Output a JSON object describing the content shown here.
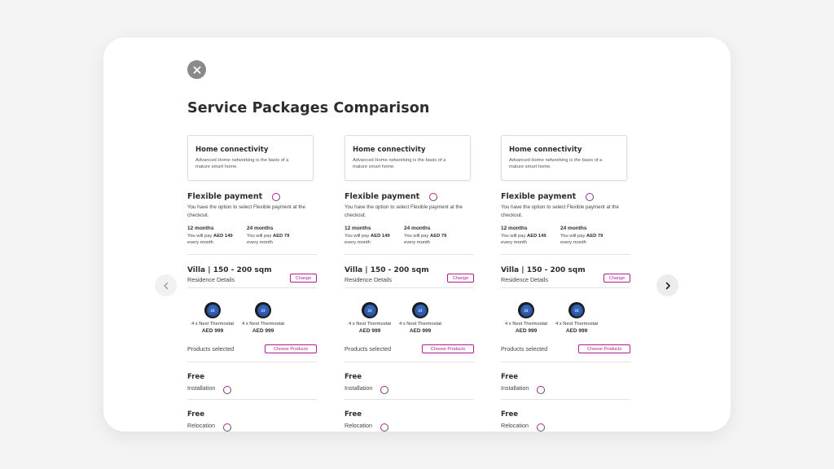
{
  "title": "Service Packages Comparison",
  "colors": {
    "accent": "#b21e8f",
    "close_bg": "#8a8a8a"
  },
  "icons": {
    "close": "close-icon",
    "prev": "chevron-left-icon",
    "next": "chevron-right-icon",
    "thermostat": "nest-thermostat-icon",
    "loading": "loading-ring-icon"
  },
  "columns": [
    {
      "card": {
        "title": "Home connectivity",
        "desc": "Advanced Home networking is the basis of a mature smart home."
      },
      "payment": {
        "title": "Flexible payment",
        "desc": "You have the option to select Flexible payment at the checkout.",
        "terms": [
          {
            "label": "12 months",
            "prefix": "You will pay ",
            "amount": "AED 149",
            "suffix": "every month"
          },
          {
            "label": "24 months",
            "prefix": "You will pay ",
            "amount": "AED 79",
            "suffix": "every month"
          }
        ]
      },
      "residence": {
        "title": "Villa | 150 - 200 sqm",
        "sub": "Residence Details",
        "change": "Change"
      },
      "products": [
        {
          "badge": "24",
          "name": "4 x Nest Thermostat",
          "price": "AED 999"
        },
        {
          "badge": "24",
          "name": "4 x Nest Thermostat",
          "price": "AED 999"
        }
      ],
      "selected": {
        "label": "Products selected",
        "button": "Choose Products"
      },
      "free": [
        {
          "title": "Free",
          "sub": "Installation"
        },
        {
          "title": "Free",
          "sub": "Relocation"
        }
      ]
    },
    {
      "card": {
        "title": "Home connectivity",
        "desc": "Advanced Home networking is the basis of a mature smart home."
      },
      "payment": {
        "title": "Flexible payment",
        "desc": "You have the option to select Flexible payment at the checkout.",
        "terms": [
          {
            "label": "12 months",
            "prefix": "You will pay ",
            "amount": "AED 149",
            "suffix": "every month"
          },
          {
            "label": "24 months",
            "prefix": "You will pay ",
            "amount": "AED 79",
            "suffix": "every month"
          }
        ]
      },
      "residence": {
        "title": "Villa | 150 - 200 sqm",
        "sub": "Residence Details",
        "change": "Change"
      },
      "products": [
        {
          "badge": "24",
          "name": "4 x Nest Thermostat",
          "price": "AED 999"
        },
        {
          "badge": "24",
          "name": "4 x Nest Thermostat",
          "price": "AED 999"
        }
      ],
      "selected": {
        "label": "Products selected",
        "button": "Choose Products"
      },
      "free": [
        {
          "title": "Free",
          "sub": "Installation"
        },
        {
          "title": "Free",
          "sub": "Relocation"
        }
      ]
    },
    {
      "card": {
        "title": "Home connectivity",
        "desc": "Advanced Home networking is the basis of a mature smart home."
      },
      "payment": {
        "title": "Flexible payment",
        "desc": "You have the option to select Flexible payment at the checkout.",
        "terms": [
          {
            "label": "12 months",
            "prefix": "You will pay ",
            "amount": "AED 149",
            "suffix": "every month"
          },
          {
            "label": "24 months",
            "prefix": "You will pay ",
            "amount": "AED 79",
            "suffix": "every month"
          }
        ]
      },
      "residence": {
        "title": "Villa | 150 - 200 sqm",
        "sub": "Residence Details",
        "change": "Change"
      },
      "products": [
        {
          "badge": "24",
          "name": "4 x Nest Thermostat",
          "price": "AED 999"
        },
        {
          "badge": "24",
          "name": "4 x Nest Thermostat",
          "price": "AED 999"
        }
      ],
      "selected": {
        "label": "Products selected",
        "button": "Choose Products"
      },
      "free": [
        {
          "title": "Free",
          "sub": "Installation"
        },
        {
          "title": "Free",
          "sub": "Relocation"
        }
      ]
    }
  ]
}
